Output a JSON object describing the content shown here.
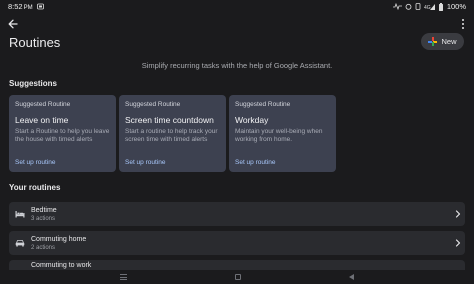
{
  "status_bar": {
    "time": "8:52",
    "time_suffix": "PM",
    "battery": "100%"
  },
  "header": {
    "title": "Routines",
    "new_button_label": "New",
    "subtitle": "Simplify recurring tasks with the help of Google Assistant."
  },
  "suggestions": {
    "heading": "Suggestions",
    "cards": [
      {
        "tag": "Suggested Routine",
        "title": "Leave on time",
        "description": "Start a Routine to help you leave the house with timed alerts",
        "link": "Set up routine"
      },
      {
        "tag": "Suggested Routine",
        "title": "Screen time countdown",
        "description": "Start a routine to help track your screen time with timed alerts",
        "link": "Set up routine"
      },
      {
        "tag": "Suggested Routine",
        "title": "Workday",
        "description": "Maintain your well-being when working from home.",
        "link": "Set up routine"
      }
    ]
  },
  "your_routines": {
    "heading": "Your routines",
    "items": [
      {
        "title": "Bedtime",
        "subtitle": "3 actions",
        "icon": "bed-icon"
      },
      {
        "title": "Commuting home",
        "subtitle": "2 actions",
        "icon": "car-icon"
      },
      {
        "title": "Commuting to work",
        "subtitle": "",
        "icon": "car-icon"
      }
    ]
  },
  "colors": {
    "background": "#1b1b1d",
    "card": "#3d4150",
    "link": "#a8c7fa",
    "row": "#2a2b2f"
  }
}
